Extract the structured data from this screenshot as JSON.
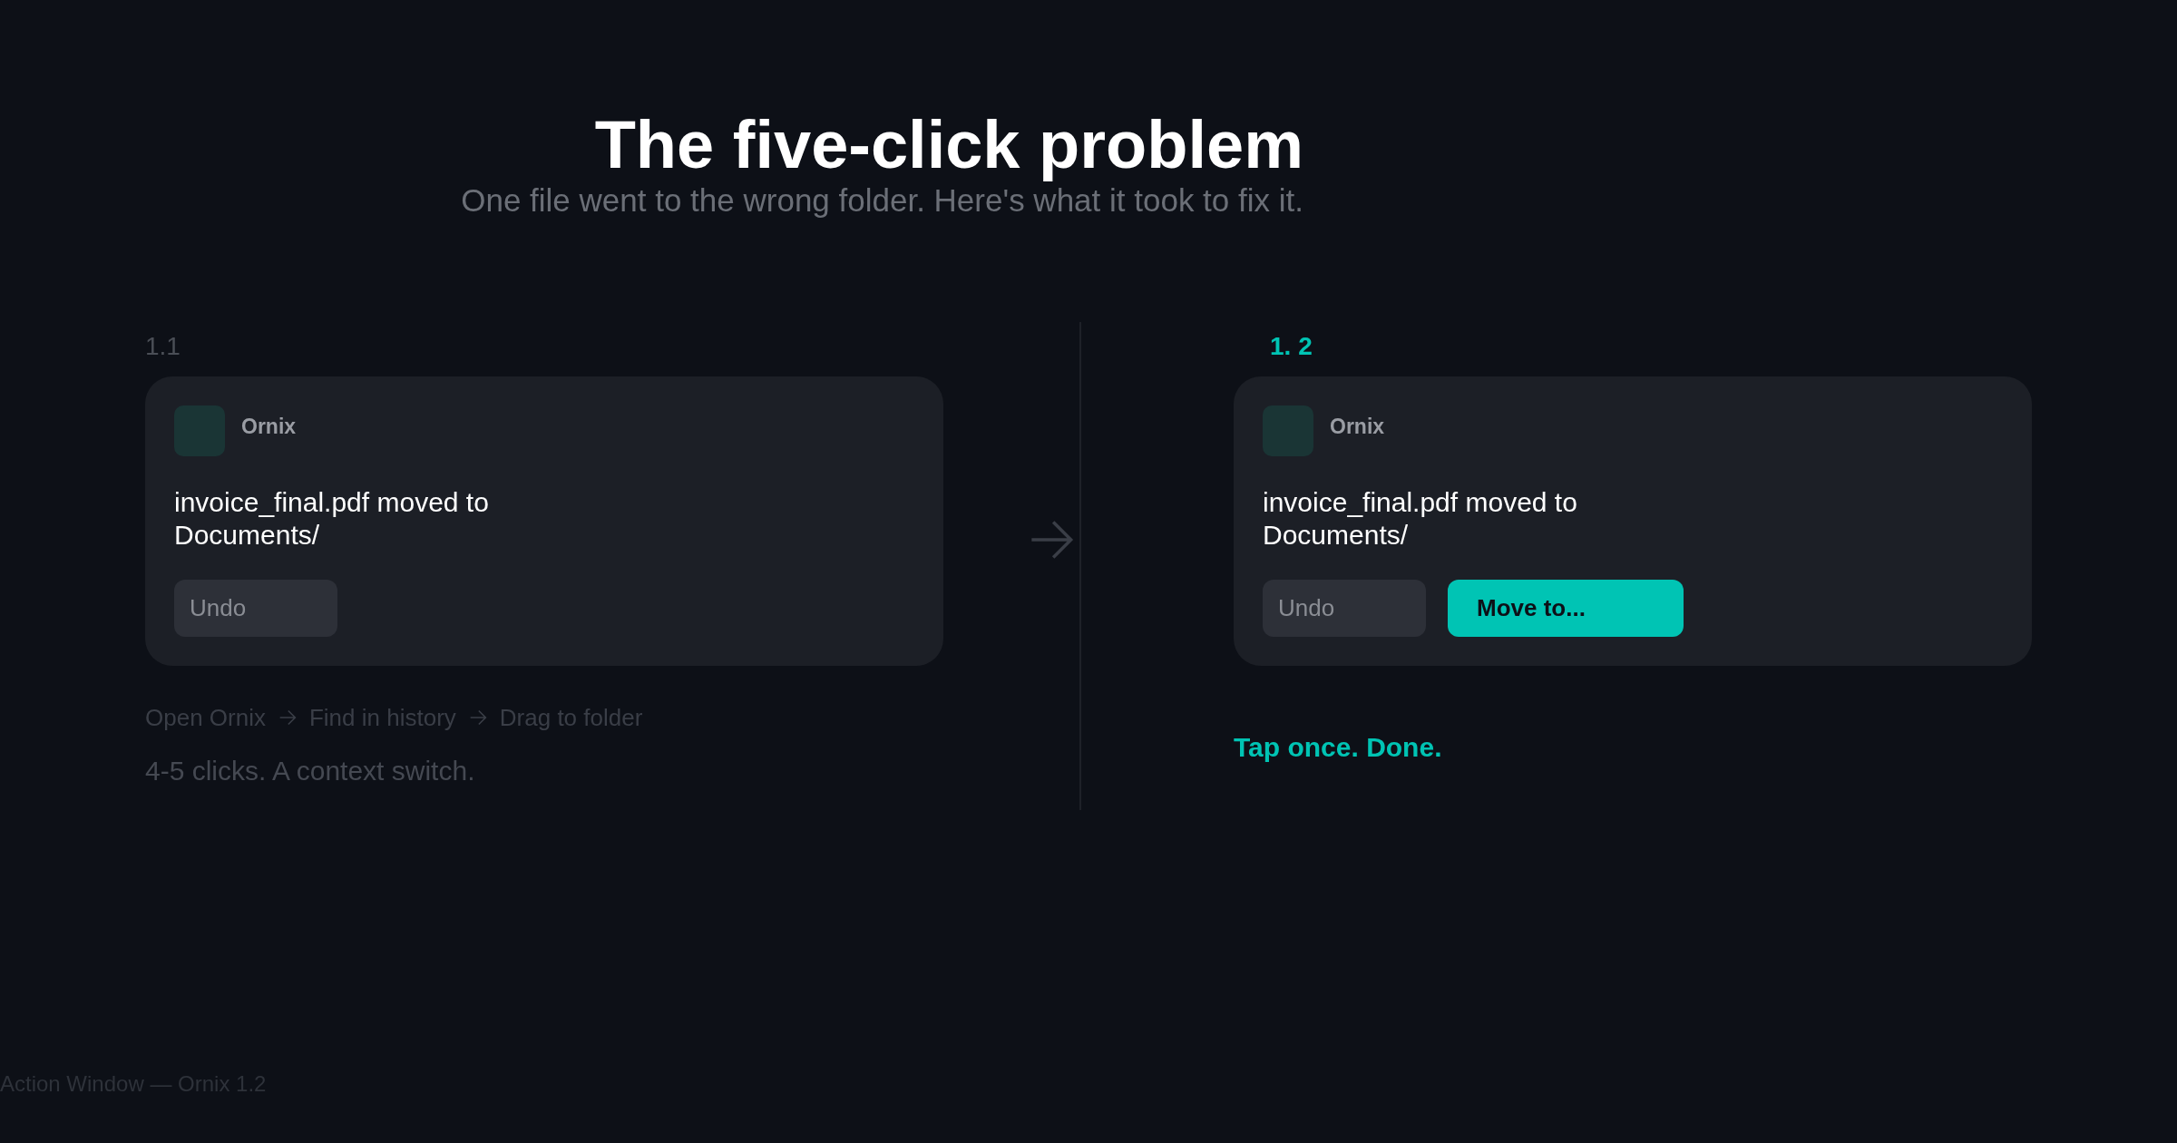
{
  "header": {
    "title": "The five-click problem",
    "subtitle": "One file went to the wrong folder. Here's what it took to fix it."
  },
  "panels": [
    {
      "label": "1.1",
      "highlighted": false,
      "card": {
        "app": "Ornix",
        "message": "invoice_final.pdf moved to Documents/",
        "actions": [
          {
            "label": "Undo",
            "kind": "secondary"
          }
        ]
      },
      "steps": [
        "Open Ornix",
        "Find in history",
        "Drag to folder"
      ],
      "note": "4-5 clicks. A context switch."
    },
    {
      "label": "1. 2",
      "highlighted": true,
      "card": {
        "app": "Ornix",
        "message": "invoice_final.pdf moved to Documents/",
        "actions": [
          {
            "label": "Undo",
            "kind": "secondary"
          },
          {
            "label": "Move to...",
            "kind": "primary"
          }
        ]
      },
      "note": "Tap once. Done."
    }
  ],
  "footer": "Action Window — Ornix 1.2"
}
